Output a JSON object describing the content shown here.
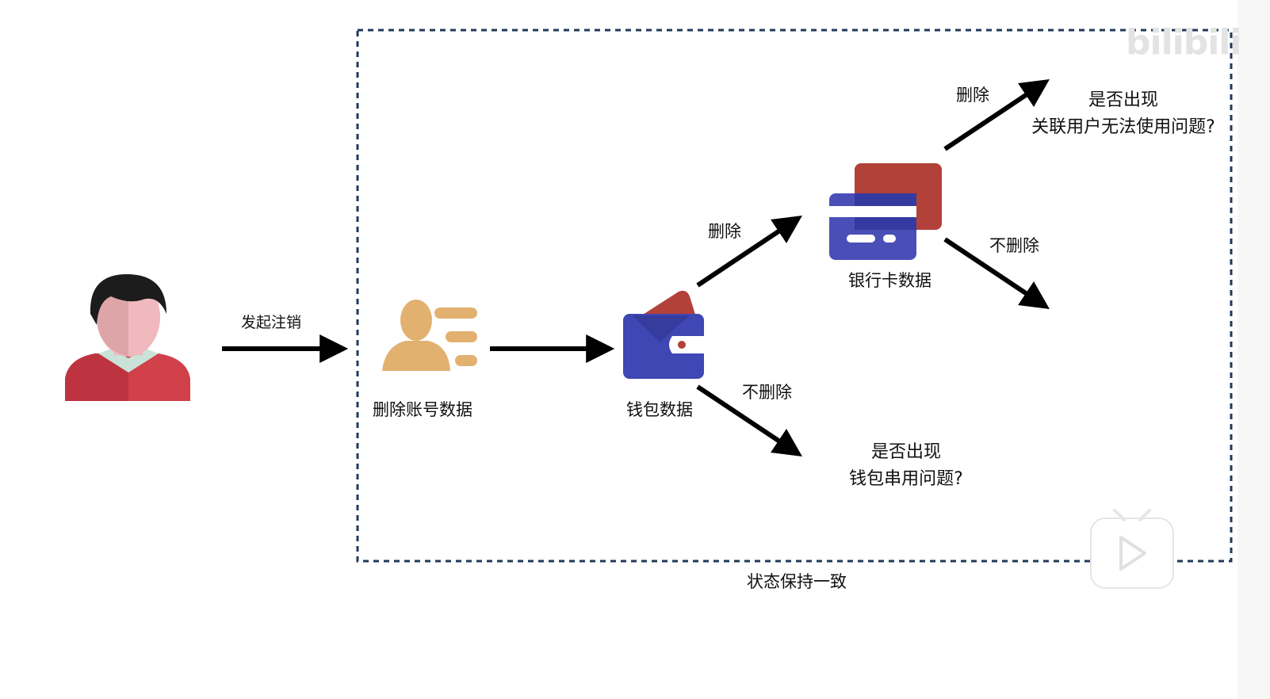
{
  "labels": {
    "initiate_cancel": "发起注销",
    "delete_account": "删除账号数据",
    "wallet_data": "钱包数据",
    "bankcard_data": "银行卡数据",
    "delete_upper": "删除",
    "no_delete_right": "不删除",
    "delete_top": "删除",
    "no_delete_lower": "不删除",
    "consistency": "状态保持一致"
  },
  "questions": {
    "linked_line1": "是否出现",
    "linked_line2": "关联用户无法使用问题?",
    "wallet_line1": "是否出现",
    "wallet_line2": "钱包串用问题?"
  },
  "watermark": "bilibili",
  "colors": {
    "arrow": "#000000",
    "dashed_border": "#1f3a5a",
    "person_shirt": "#d0414a",
    "person_skin": "#f0b9bd",
    "person_hair": "#1c1c1c",
    "collar": "#c9e3d8",
    "account_icon": "#e2b170",
    "wallet_blue": "#3f47b5",
    "wallet_red": "#b2413a",
    "card_red": "#b2413a",
    "card_blue": "#4a4fb8"
  }
}
